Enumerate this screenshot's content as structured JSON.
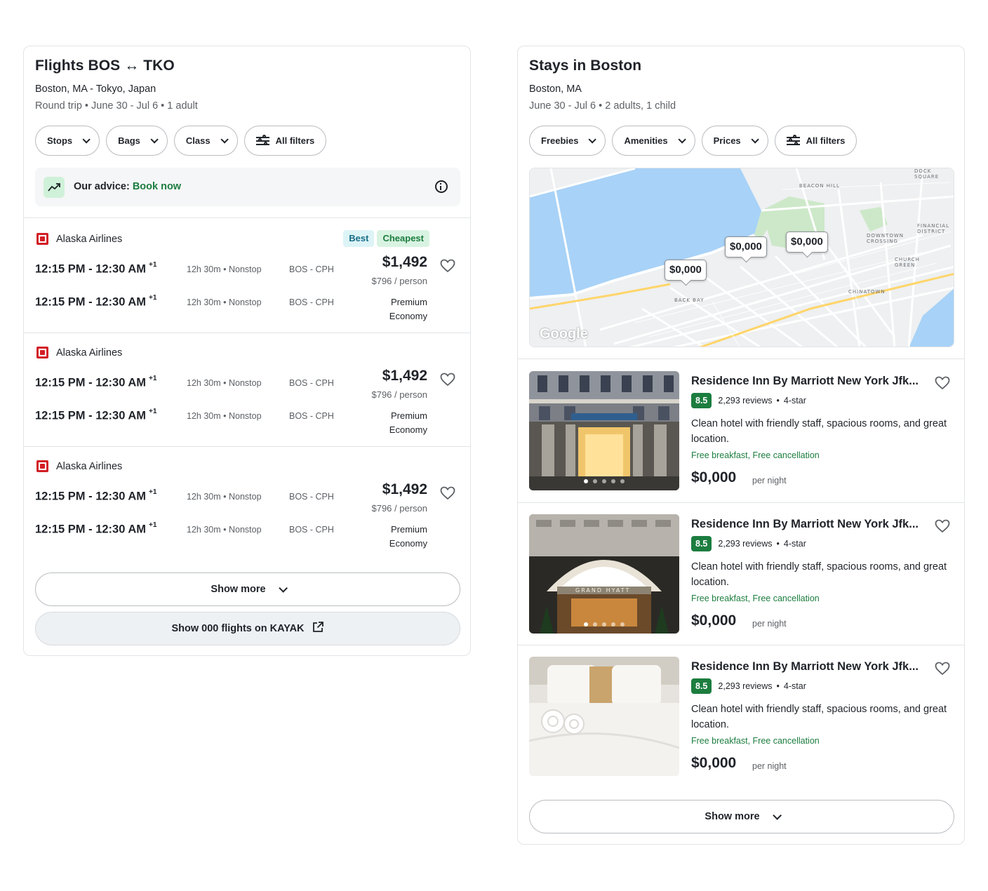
{
  "flights": {
    "title": "Flights BOS ↔ TKO",
    "subtitle": "Boston, MA - Tokyo, Japan",
    "details": "Round trip • June 30 - Jul 6 • 1 adult",
    "filters": [
      "Stops",
      "Bags",
      "Class"
    ],
    "all_filters": "All filters",
    "advice_label": "Our advice:",
    "advice_value": "Book now",
    "results": [
      {
        "airline": "Alaska Airlines",
        "badges": [
          "Best",
          "Cheapest"
        ],
        "legs": [
          {
            "times": "12:15 PM - 12:30 AM",
            "plus": "+1",
            "duration": "12h 30m • Nonstop",
            "route": "BOS - CPH"
          },
          {
            "times": "12:15 PM - 12:30 AM",
            "plus": "+1",
            "duration": "12h 30m • Nonstop",
            "route": "BOS - CPH"
          }
        ],
        "price": "$1,492",
        "per_person": "$796 / person",
        "cabin": "Premium Economy"
      },
      {
        "airline": "Alaska Airlines",
        "badges": [],
        "legs": [
          {
            "times": "12:15 PM - 12:30 AM",
            "plus": "+1",
            "duration": "12h 30m • Nonstop",
            "route": "BOS - CPH"
          },
          {
            "times": "12:15 PM - 12:30 AM",
            "plus": "+1",
            "duration": "12h 30m • Nonstop",
            "route": "BOS - CPH"
          }
        ],
        "price": "$1,492",
        "per_person": "$796 / person",
        "cabin": "Premium Economy"
      },
      {
        "airline": "Alaska Airlines",
        "badges": [],
        "legs": [
          {
            "times": "12:15 PM - 12:30 AM",
            "plus": "+1",
            "duration": "12h 30m • Nonstop",
            "route": "BOS - CPH"
          },
          {
            "times": "12:15 PM - 12:30 AM",
            "plus": "+1",
            "duration": "12h 30m • Nonstop",
            "route": "BOS - CPH"
          }
        ],
        "price": "$1,492",
        "per_person": "$796 / person",
        "cabin": "Premium Economy"
      }
    ],
    "show_more": "Show more",
    "show_kayak": "Show 000 flights on KAYAK"
  },
  "stays": {
    "title": "Stays in Boston",
    "subtitle": "Boston, MA",
    "details": "June 30 - Jul 6 • 2 adults, 1 child",
    "filters": [
      "Freebies",
      "Amenities",
      "Prices"
    ],
    "all_filters": "All filters",
    "map": {
      "pins": [
        "$0,000",
        "$0,000",
        "$0,000"
      ],
      "labels": [
        "BEACON HILL",
        "BACK BAY",
        "CHINATOWN",
        "DOWNTOWN CROSSING",
        "FINANCIAL DISTRICT",
        "CHURCH GREEN",
        "DOCK SQUARE"
      ],
      "provider": "Google"
    },
    "hotels": [
      {
        "name": "Residence Inn By Marriott New York Jfk...",
        "score": "8.5",
        "reviews": "2,293 reviews",
        "stars": "4-star",
        "description": "Clean hotel with friendly staff, spacious rooms, and great location.",
        "perks": "Free breakfast, Free cancellation",
        "price": "$0,000",
        "per_night": "per night",
        "image": "facade"
      },
      {
        "name": "Residence Inn By Marriott New York Jfk...",
        "score": "8.5",
        "reviews": "2,293 reviews",
        "stars": "4-star",
        "description": "Clean hotel with friendly staff, spacious rooms, and great location.",
        "perks": "Free breakfast, Free cancellation",
        "price": "$0,000",
        "per_night": "per night",
        "image": "grand-hyatt",
        "sign": "GRAND HYATT"
      },
      {
        "name": "Residence Inn By Marriott New York Jfk...",
        "score": "8.5",
        "reviews": "2,293 reviews",
        "stars": "4-star",
        "description": "Clean hotel with friendly staff, spacious rooms, and great location.",
        "perks": "Free breakfast, Free cancellation",
        "price": "$0,000",
        "per_night": "per night",
        "image": "bed"
      }
    ],
    "show_more": "Show more"
  },
  "colors": {
    "accent_green": "#1c7d3f",
    "badge_best_bg": "#ddf4f7",
    "badge_cheap_bg": "#d9f3e2",
    "airline_red": "#d21f26",
    "map_water": "#a8d2f7"
  }
}
